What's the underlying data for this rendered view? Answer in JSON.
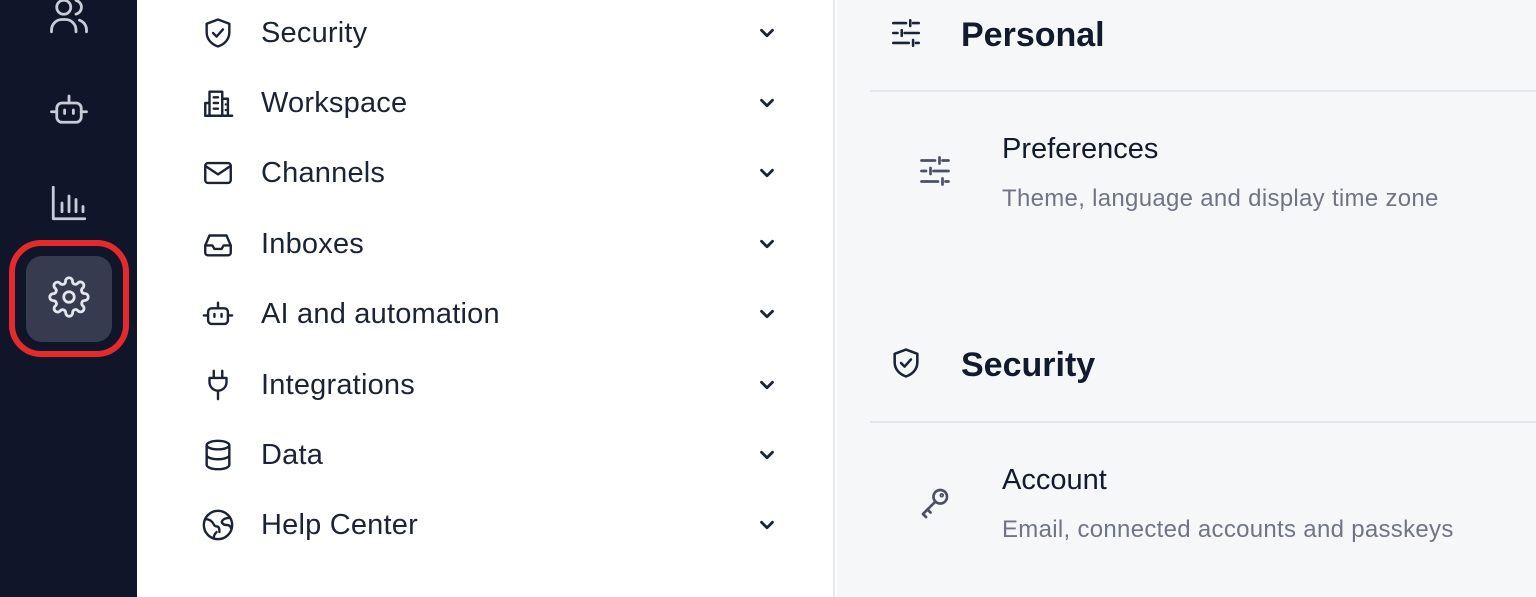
{
  "rail": {
    "items": [
      {
        "icon": "users-icon"
      },
      {
        "icon": "bot-icon"
      },
      {
        "icon": "bar-chart-icon"
      },
      {
        "icon": "gear-icon",
        "active": true
      }
    ],
    "highlight_color": "#e32b2b"
  },
  "nav": {
    "items": [
      {
        "label": "Security",
        "icon": "shield-check-icon"
      },
      {
        "label": "Workspace",
        "icon": "building-icon"
      },
      {
        "label": "Channels",
        "icon": "mail-icon"
      },
      {
        "label": "Inboxes",
        "icon": "inbox-icon"
      },
      {
        "label": "AI and automation",
        "icon": "bot-icon"
      },
      {
        "label": "Integrations",
        "icon": "plug-icon"
      },
      {
        "label": "Data",
        "icon": "database-icon"
      },
      {
        "label": "Help Center",
        "icon": "globe-icon"
      }
    ]
  },
  "content": {
    "sections": [
      {
        "title": "Personal",
        "icon": "sliders-icon",
        "cards": [
          {
            "title": "Preferences",
            "description": "Theme, language and display time zone",
            "icon": "sliders-icon"
          }
        ]
      },
      {
        "title": "Security",
        "icon": "shield-check-icon",
        "cards": [
          {
            "title": "Account",
            "description": "Email, connected accounts and passkeys",
            "icon": "key-icon"
          }
        ]
      }
    ]
  }
}
